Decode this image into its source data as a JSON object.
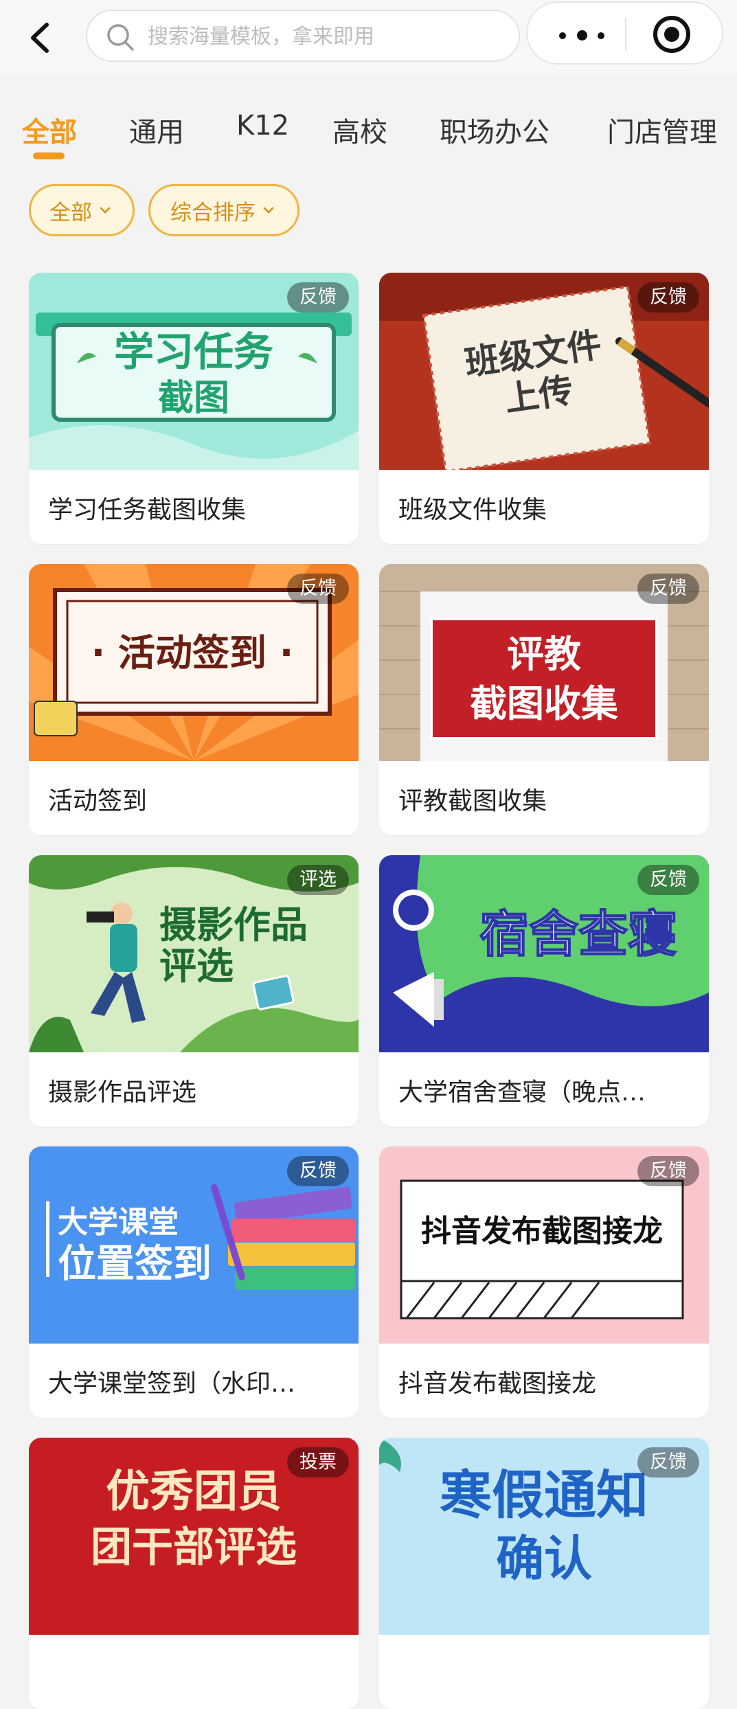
{
  "header": {
    "search_placeholder": "搜索海量模板，拿来即用",
    "icons": [
      "back-chevron-icon",
      "search-icon",
      "more-dots-icon",
      "target-icon"
    ]
  },
  "tabs": [
    {
      "label": "全部",
      "active": true
    },
    {
      "label": "通用",
      "active": false
    },
    {
      "label": "K12",
      "active": false
    },
    {
      "label": "高校",
      "active": false
    },
    {
      "label": "职场办公",
      "active": false
    },
    {
      "label": "门店管理",
      "active": false
    }
  ],
  "filters": [
    {
      "label": "全部"
    },
    {
      "label": "综合排序"
    }
  ],
  "cards": [
    {
      "title": "学习任务截图收集",
      "badge": "反馈",
      "art": [
        "学习任务",
        "截图"
      ]
    },
    {
      "title": "班级文件收集",
      "badge": "反馈",
      "art": [
        "班级文件",
        "上传"
      ]
    },
    {
      "title": "活动签到",
      "badge": "反馈",
      "art": [
        "· 活动签到 ·"
      ]
    },
    {
      "title": "评教截图收集",
      "badge": "反馈",
      "art": [
        "评教",
        "截图收集"
      ]
    },
    {
      "title": "摄影作品评选",
      "badge": "评选",
      "art": [
        "摄影作品",
        "评选"
      ]
    },
    {
      "title": "大学宿舍查寝（晚点…",
      "badge": "反馈",
      "art": [
        "宿舍查寝"
      ]
    },
    {
      "title": "大学课堂签到（水印…",
      "badge": "反馈",
      "art": [
        "大学课堂",
        "位置签到"
      ]
    },
    {
      "title": "抖音发布截图接龙",
      "badge": "反馈",
      "art": [
        "抖音发布截图接龙"
      ]
    },
    {
      "title": "",
      "badge": "投票",
      "art": [
        "优秀团员",
        "团干部评选"
      ]
    },
    {
      "title": "",
      "badge": "反馈",
      "art": [
        "寒假通知",
        "确认"
      ]
    }
  ],
  "colors": {
    "accent": "#f39a1e",
    "chip_border": "#f1b441",
    "chip_bg": "#fff6df"
  }
}
